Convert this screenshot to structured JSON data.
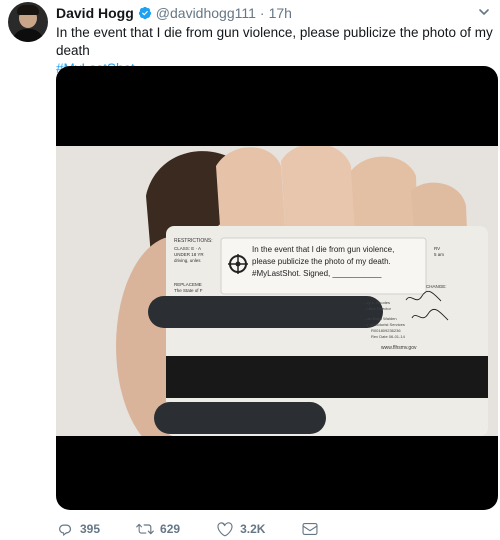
{
  "tweet": {
    "author_name": "David Hogg",
    "handle": "@davidhogg111",
    "separator": "·",
    "time": "17h",
    "text": "In the event that I die from gun violence, please publicize the photo of my death",
    "hashtag": "#MyLastShot"
  },
  "photo": {
    "card_restrictions": "RESTRICTIONS:",
    "card_class": "CLASS: E · A",
    "card_under": "UNDER 18 YR",
    "card_driving": "driving, unles",
    "card_rv": "RV",
    "card_am": "5 am",
    "card_replacement": "REPLACEME",
    "card_state": "The State of F",
    "card_change": "CHANGE:",
    "card_official1": "...ry L. Rhodes",
    "card_official2": "...utive Director",
    "card_official3": "...an Boyd Walden",
    "card_official4": "...r of Motorist Services",
    "card_code": "R001809236236",
    "card_rev": "Rev Date 06-01-14",
    "card_url": "www.flhsmv.gov",
    "sticker_line1": "In the event that I die from gun violence,",
    "sticker_line2": "please publicize the photo of my death.",
    "sticker_line3": "#MyLastShot. Signed, ___________"
  },
  "actions": {
    "reply_count": "395",
    "retweet_count": "629",
    "like_count": "3.2K"
  },
  "colors": {
    "accent": "#1da1f2",
    "secondary_text": "#657786",
    "primary_text": "#14171a"
  },
  "icons": [
    "verified-badge-icon",
    "chevron-down-icon",
    "reply-icon",
    "retweet-icon",
    "like-icon",
    "direct-message-icon"
  ]
}
